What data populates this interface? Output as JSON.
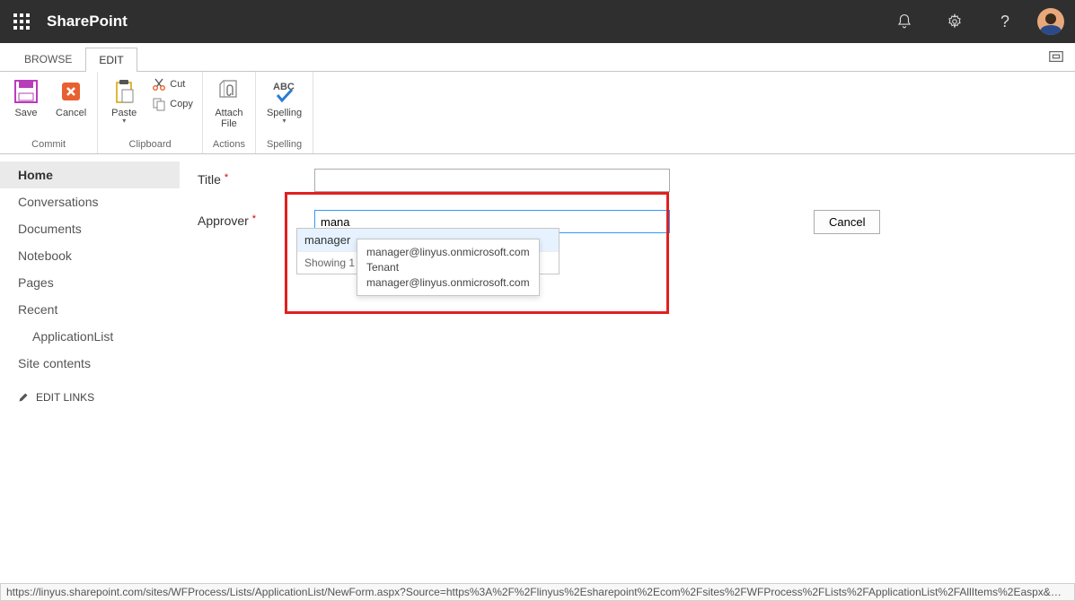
{
  "header": {
    "brand": "SharePoint"
  },
  "tabs": {
    "browse": "BROWSE",
    "edit": "EDIT"
  },
  "ribbon": {
    "commit": {
      "label": "Commit",
      "save": "Save",
      "cancel": "Cancel"
    },
    "clipboard": {
      "label": "Clipboard",
      "paste": "Paste",
      "cut": "Cut",
      "copy": "Copy"
    },
    "actions": {
      "label": "Actions",
      "attach": "Attach\nFile"
    },
    "spelling": {
      "label": "Spelling",
      "btn": "Spelling"
    }
  },
  "nav": {
    "items": [
      "Home",
      "Conversations",
      "Documents",
      "Notebook",
      "Pages",
      "Recent"
    ],
    "sub": "ApplicationList",
    "site_contents": "Site contents",
    "edit_links": "EDIT LINKS"
  },
  "form": {
    "title_label": "Title",
    "approver_label": "Approver",
    "approver_value": "mana",
    "cancel": "Cancel"
  },
  "picker": {
    "option": "manager",
    "status": "Showing 1 result",
    "tooltip_line1": "manager@linyus.onmicrosoft.com",
    "tooltip_line2": "Tenant",
    "tooltip_line3": "manager@linyus.onmicrosoft.com"
  },
  "statusbar": "https://linyus.sharepoint.com/sites/WFProcess/Lists/ApplicationList/NewForm.aspx?Source=https%3A%2F%2Flinyus%2Esharepoint%2Ecom%2Fsites%2FWFProcess%2FLists%2FApplicationList%2FAllItems%2Easpx&Ro..."
}
